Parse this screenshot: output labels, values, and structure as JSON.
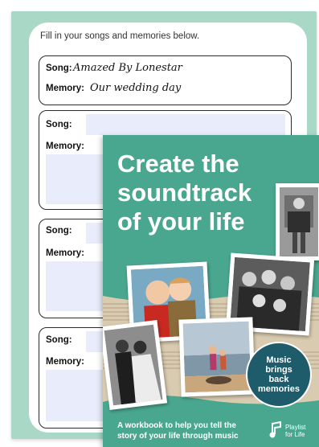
{
  "worksheet": {
    "intro": "Fill in your songs and memories below.",
    "song_label": "Song:",
    "memory_label": "Memory:",
    "entries": [
      {
        "song": "Amazed By Lonestar",
        "memory": "Our wedding day"
      },
      {
        "song": "",
        "memory": ""
      },
      {
        "song": "",
        "memory": ""
      },
      {
        "song": "",
        "memory": ""
      }
    ]
  },
  "cover": {
    "title_lines": [
      "Create the",
      "soundtrack",
      "of your life"
    ],
    "badge_lines": [
      "Music",
      "brings",
      "back",
      "memories"
    ],
    "tagline": "A workbook to help you tell the story of your life through music",
    "logo_lines": [
      "Playlist",
      "for Life"
    ]
  },
  "colors": {
    "worksheet_bg": "#a9d8c6",
    "cover_bg": "#4aa78f",
    "badge_bg": "#1f5c6b",
    "fill_box": "#e9ecfa"
  }
}
